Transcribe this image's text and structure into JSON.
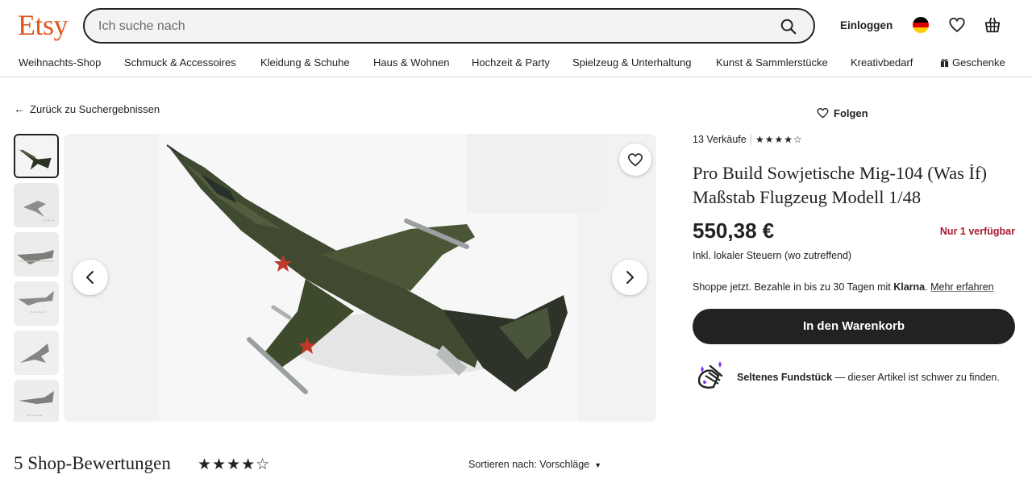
{
  "header": {
    "logo": "Etsy",
    "search_placeholder": "Ich suche nach",
    "signin_label": "Einloggen",
    "flag_colors": [
      "#000000",
      "#dd0000",
      "#ffce00"
    ]
  },
  "nav": {
    "items": [
      "Weihnachts-Shop",
      "Schmuck & Accessoires",
      "Kleidung & Schuhe",
      "Haus & Wohnen",
      "Hochzeit & Party",
      "Spielzeug & Unterhaltung",
      "Kunst & Sammlerstücke",
      "Kreativbedarf",
      "Geschenke"
    ]
  },
  "back_label": "Zurück zu Suchergebnissen",
  "gallery": {
    "thumbnail_count": 6,
    "selected_index": 0
  },
  "listing": {
    "follow_label": "Folgen",
    "sales": "13 Verkäufe",
    "stars_small": "★★★★☆",
    "title": "Pro Build Sowjetische Mig-104 (Was İf) Maßstab Flugzeug Modell 1/48",
    "price": "550,38 €",
    "stock": "Nur 1 verfügbar",
    "tax": "Inkl. lokaler Steuern (wo zutreffend)",
    "klarna_prefix": "Shoppe jetzt. Bezahle in bis zu 30 Tagen mit ",
    "klarna_brand": "Klarna",
    "klarna_suffix": ". ",
    "klarna_more": "Mehr erfahren",
    "cart_label": "In den Warenkorb",
    "rare_bold": "Seltenes Fundstück",
    "rare_text": " — dieser Artikel ist schwer zu finden.",
    "stock_color": "#a61a2e"
  },
  "reviews": {
    "title": "5 Shop-Bewertungen",
    "stars": "★★★★☆",
    "sort_label": "Sortieren nach: Vorschläge"
  },
  "colors": {
    "brand": "#e0561f",
    "button_dark": "#222222"
  }
}
